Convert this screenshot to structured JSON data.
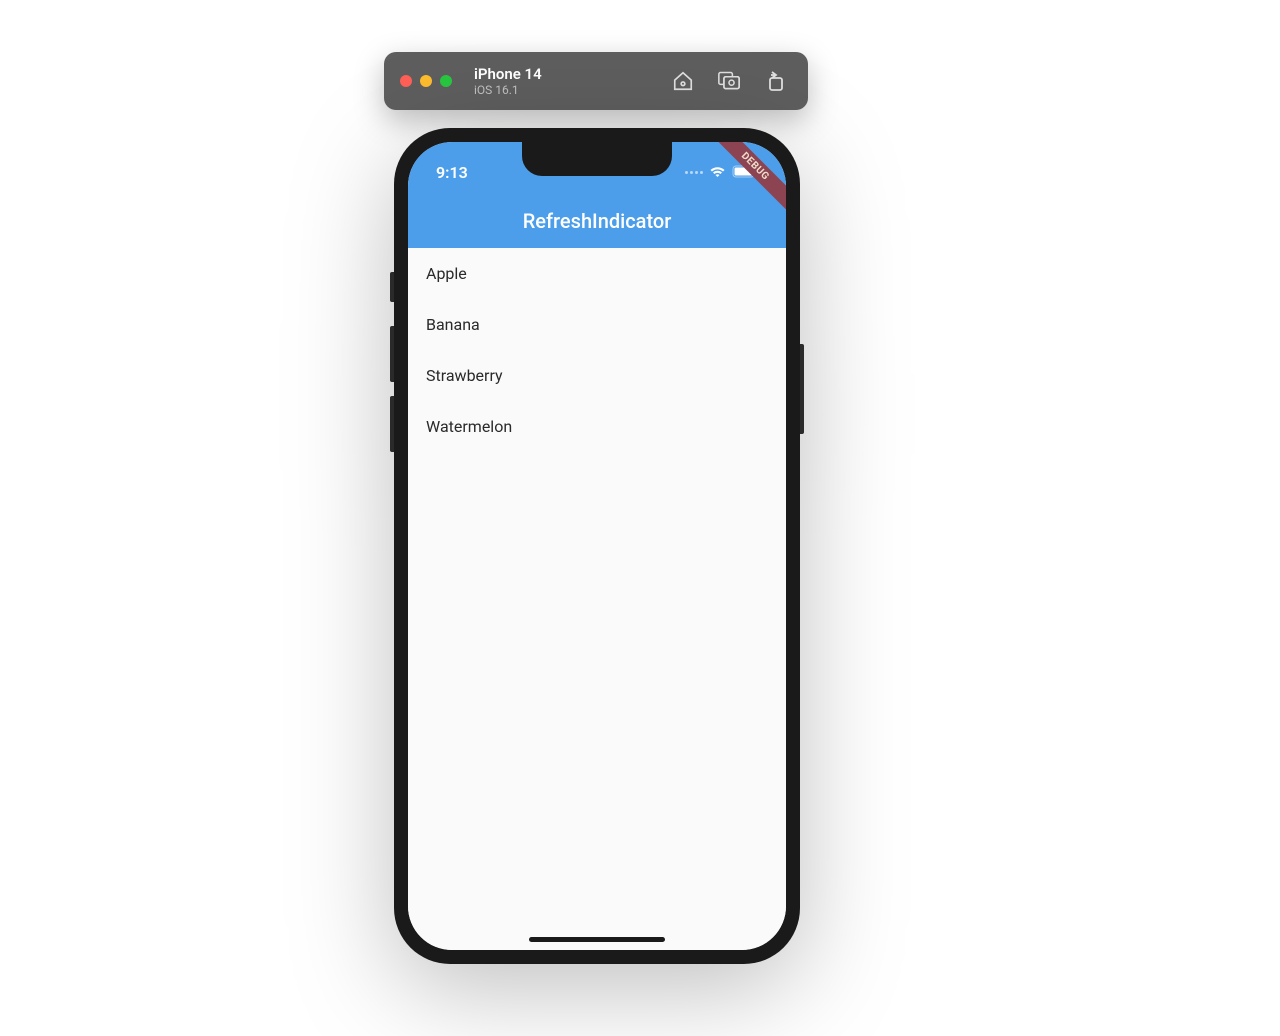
{
  "simulator": {
    "device_name": "iPhone 14",
    "os_version": "iOS 16.1"
  },
  "status_bar": {
    "time": "9:13"
  },
  "app": {
    "title": "RefreshIndicator",
    "debug_label": "DEBUG"
  },
  "list_items": [
    "Apple",
    "Banana",
    "Strawberry",
    "Watermelon"
  ]
}
